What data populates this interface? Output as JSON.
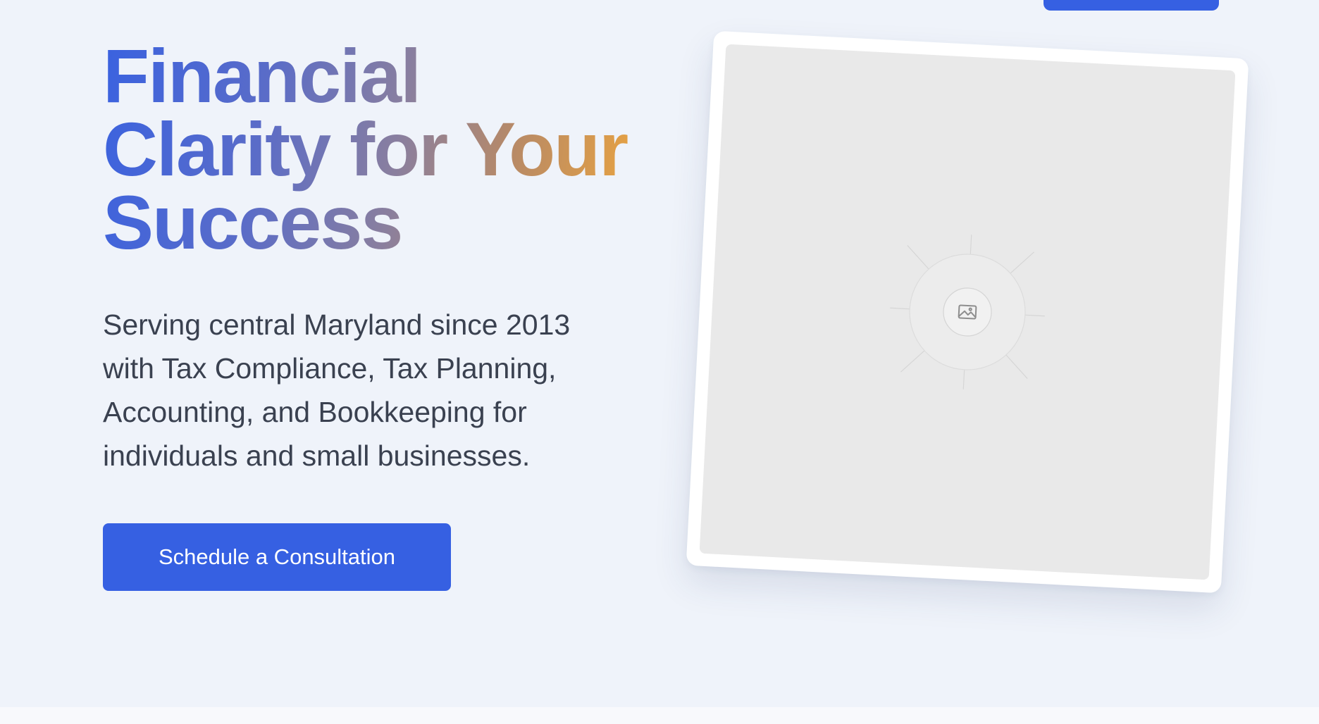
{
  "nav": {
    "cta_label": ""
  },
  "hero": {
    "headline": {
      "line1": "Financial",
      "line2": "Clarity for Your",
      "line3": "Success"
    },
    "subtext": "Serving central Maryland since 2013 with Tax Compliance, Tax Planning, Accounting, and Bookkeeping for individuals and small businesses.",
    "primary_cta": "Schedule a Consultation",
    "image": {
      "icon": "image-placeholder-icon"
    }
  },
  "colors": {
    "accent": "#3660e2",
    "background": "#eff3fa",
    "body_text": "#3a4150",
    "gradient_start": "#3a62e0",
    "gradient_end": "#e3a045"
  }
}
